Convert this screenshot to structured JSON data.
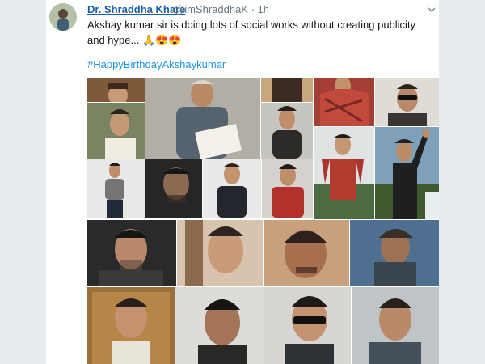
{
  "tweet": {
    "display_name": "Dr. Shraddha Khare",
    "handle": "@imShraddhaK",
    "separator": "·",
    "time": "1h",
    "text": "Akshay kumar sir is doing lots of social works without creating publicity and hype...",
    "emojis": "🙏😍😍",
    "hashtag": "#HappyBirthdayAkshaykumar"
  },
  "colors": {
    "name": "#1b5fa5",
    "hashtag": "#1b95e0",
    "muted": "#657786",
    "text": "#14171a"
  }
}
